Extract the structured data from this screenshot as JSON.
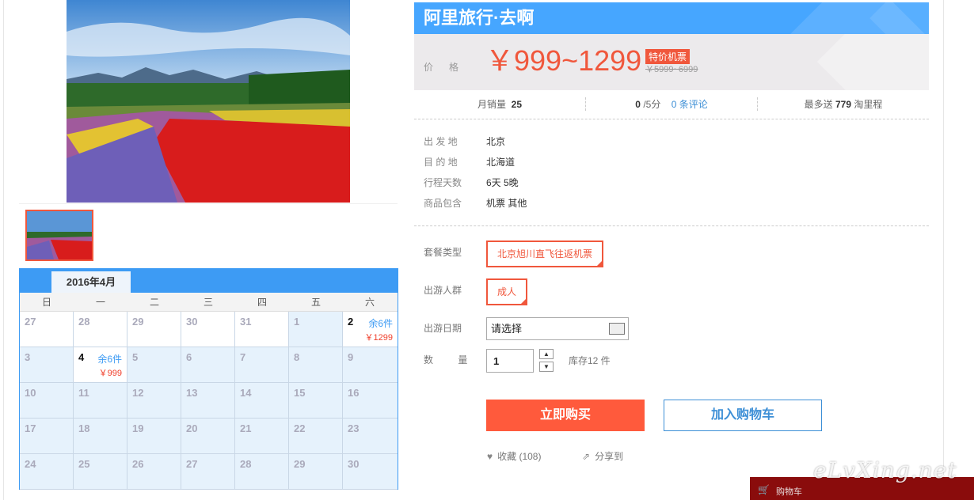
{
  "colors": {
    "accent_red": "#f0573c",
    "accent_blue": "#3d9bf4",
    "cart_bar": "#8a0c0c"
  },
  "product": {
    "title": "阿里旅行·去啊",
    "price_label": "价格",
    "price_range": "￥999~1299",
    "price_tag": "特价机票",
    "original_price": "￥5999~6999"
  },
  "stats": {
    "monthly_sales_label": "月销量",
    "monthly_sales": "25",
    "rating": "0",
    "rating_suffix": "/5分",
    "reviews_link": "0 条评论",
    "points_prefix": "最多送",
    "points": "779",
    "points_suffix": "淘里程"
  },
  "info": [
    {
      "label": "出 发 地",
      "value": "北京"
    },
    {
      "label": "目 的 地",
      "value": "北海道"
    },
    {
      "label": "行程天数",
      "value": "6天 5晚"
    },
    {
      "label": "商品包含",
      "value": "机票  其他"
    }
  ],
  "options": {
    "package_label": "套餐类型",
    "package_value": "北京旭川直飞往返机票",
    "traveler_label": "出游人群",
    "traveler_value": "成人",
    "date_label": "出游日期",
    "date_placeholder": "请选择",
    "qty_label": "数  量",
    "qty_value": "1",
    "stock": "库存12 件"
  },
  "actions": {
    "buy_now": "立即购买",
    "add_to_cart": "加入购物车",
    "favorite": "收藏 (108)",
    "share": "分享到"
  },
  "calendar": {
    "month": "2016年4月",
    "weekdays": [
      "日",
      "一",
      "二",
      "三",
      "四",
      "五",
      "六"
    ],
    "rows": [
      [
        {
          "d": "27",
          "t": "prev"
        },
        {
          "d": "28",
          "t": "prev"
        },
        {
          "d": "29",
          "t": "prev"
        },
        {
          "d": "30",
          "t": "prev"
        },
        {
          "d": "31",
          "t": "prev"
        },
        {
          "d": "1"
        },
        {
          "d": "2",
          "t": "avail",
          "stock": "余6件",
          "price": "￥1299"
        }
      ],
      [
        {
          "d": "3"
        },
        {
          "d": "4",
          "t": "avail",
          "stock": "余6件",
          "price": "￥999"
        },
        {
          "d": "5"
        },
        {
          "d": "6"
        },
        {
          "d": "7"
        },
        {
          "d": "8"
        },
        {
          "d": "9"
        }
      ],
      [
        {
          "d": "10"
        },
        {
          "d": "11"
        },
        {
          "d": "12"
        },
        {
          "d": "13"
        },
        {
          "d": "14"
        },
        {
          "d": "15"
        },
        {
          "d": "16"
        }
      ],
      [
        {
          "d": "17"
        },
        {
          "d": "18"
        },
        {
          "d": "19"
        },
        {
          "d": "20"
        },
        {
          "d": "21"
        },
        {
          "d": "22"
        },
        {
          "d": "23"
        }
      ],
      [
        {
          "d": "24"
        },
        {
          "d": "25"
        },
        {
          "d": "26"
        },
        {
          "d": "27"
        },
        {
          "d": "28"
        },
        {
          "d": "29"
        },
        {
          "d": "30"
        }
      ]
    ]
  },
  "footer": {
    "cart_label": "购物车",
    "watermark": "eLvXing.net"
  }
}
